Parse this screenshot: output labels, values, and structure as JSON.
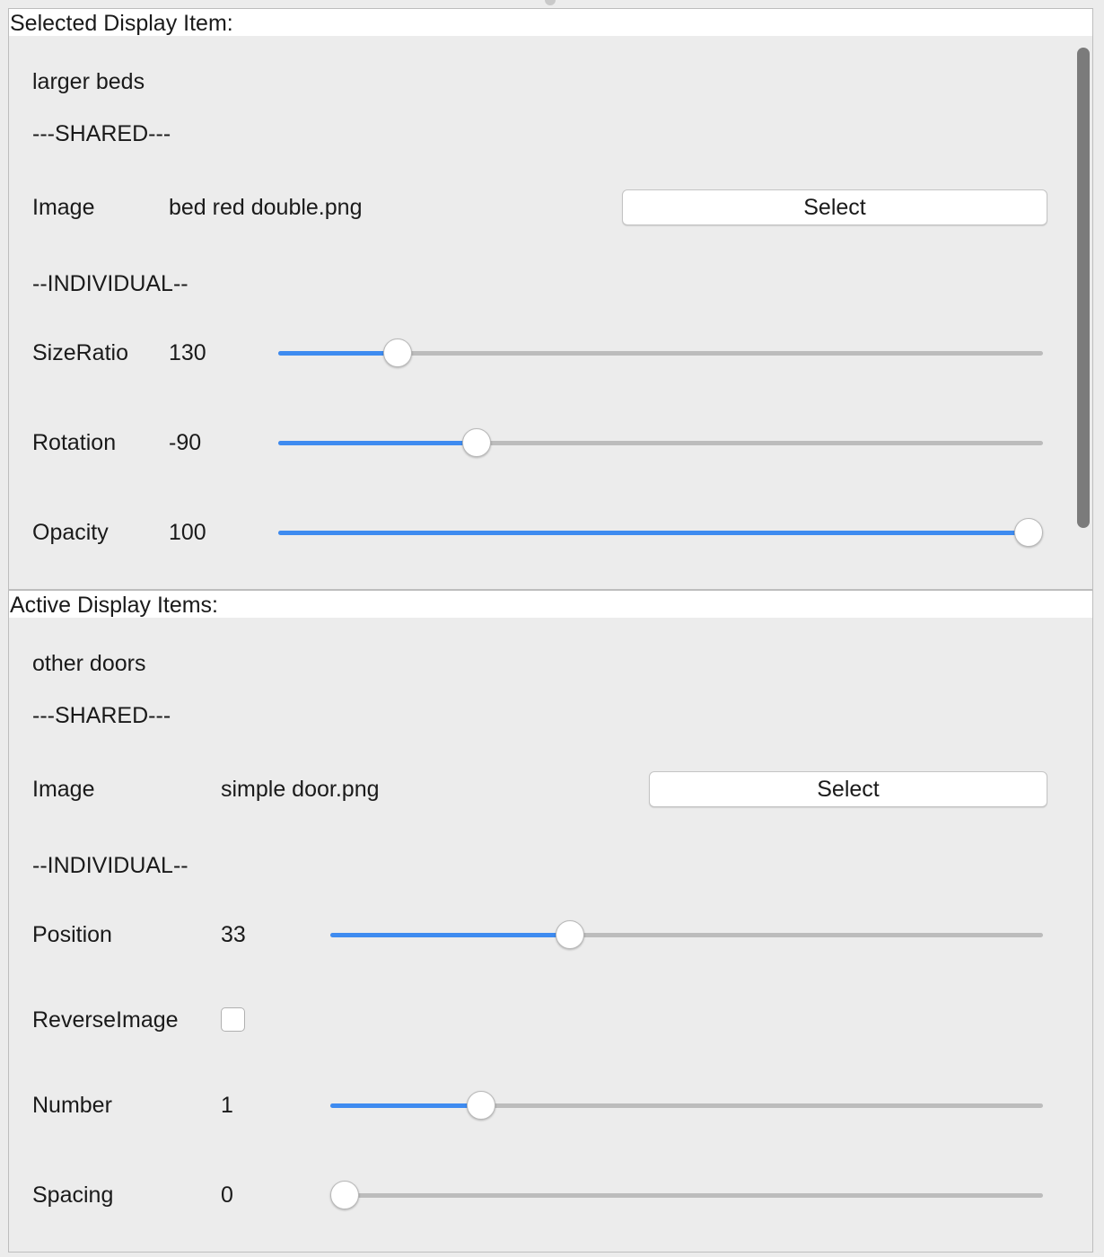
{
  "selected": {
    "header": "Selected Display Item:",
    "name": "larger beds",
    "shared_label": "---SHARED---",
    "image_label": "Image",
    "image_value": "bed red double.png",
    "select_label": "Select",
    "individual_label": "--INDIVIDUAL--",
    "sliders": [
      {
        "label": "SizeRatio",
        "value": "130",
        "fraction": 0.143
      },
      {
        "label": "Rotation",
        "value": "-90",
        "fraction": 0.25
      },
      {
        "label": "Opacity",
        "value": "100",
        "fraction": 1.0
      }
    ]
  },
  "active": {
    "header": "Active Display Items:",
    "name": "other doors",
    "shared_label": "---SHARED---",
    "image_label": "Image",
    "image_value": "simple door.png",
    "select_label": "Select",
    "individual_label": "--INDIVIDUAL--",
    "position": {
      "label": "Position",
      "value": "33",
      "fraction": 0.33
    },
    "reverse_image": {
      "label": "ReverseImage",
      "checked": false
    },
    "number": {
      "label": "Number",
      "value": "1",
      "fraction": 0.2
    },
    "spacing": {
      "label": "Spacing",
      "value": "0",
      "fraction": 0.0
    }
  },
  "colors": {
    "accent": "#3e8bf0",
    "track": "#bcbcbc",
    "panel_bg": "#ececec"
  }
}
